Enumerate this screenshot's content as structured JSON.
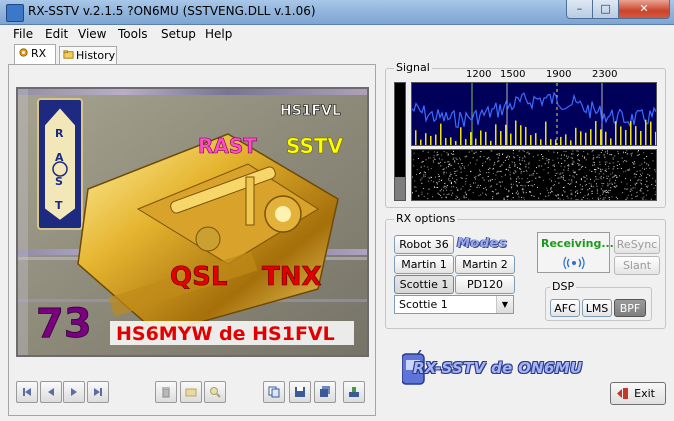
{
  "window": {
    "title": "RX-SSTV v.2.1.5 ?ON6MU (SSTVENG.DLL v.1.06)",
    "minimize": "–",
    "maximize": "□",
    "close": "✕"
  },
  "menu": [
    "File",
    "Edit",
    "View",
    "Tools",
    "Setup",
    "Help"
  ],
  "tabs": {
    "rx": "RX",
    "history": "History"
  },
  "image": {
    "callsign_top": "HS1FVL",
    "rast": "RAST",
    "sstv": "SSTV",
    "qsl": "QSL",
    "tnx": "TNX",
    "number": "73",
    "bottom_text": "HS6MYW de HS1FVL",
    "emblem_letters": [
      "R",
      "A",
      "S",
      "T"
    ]
  },
  "signal": {
    "label": "Signal",
    "freq_ticks": [
      "1200",
      "1500",
      "1900",
      "2300"
    ],
    "level_fraction": 0.2
  },
  "rx_options": {
    "label": "RX options",
    "modes_label": "Modes",
    "mode_buttons": [
      {
        "label": "Robot 36"
      },
      {
        "label": "Martin 1"
      },
      {
        "label": "Martin 2"
      },
      {
        "label": "Scottie 1"
      },
      {
        "label": "PD120"
      }
    ],
    "selected_mode": "Scottie 1",
    "status": "Receiving...",
    "resync": "ReSync",
    "slant": "Slant"
  },
  "dsp": {
    "label": "DSP",
    "afc": "AFC",
    "lms": "LMS",
    "bpf": "BPF"
  },
  "logo_text": "RX-SSTV de ON6MU",
  "exit_label": "Exit",
  "colors": {
    "spectrum_bg": "#00005a",
    "spectrum_line": "#3d6bff",
    "spectrum_peaks": "#f2e600",
    "receiving": "#1c9a1c"
  }
}
